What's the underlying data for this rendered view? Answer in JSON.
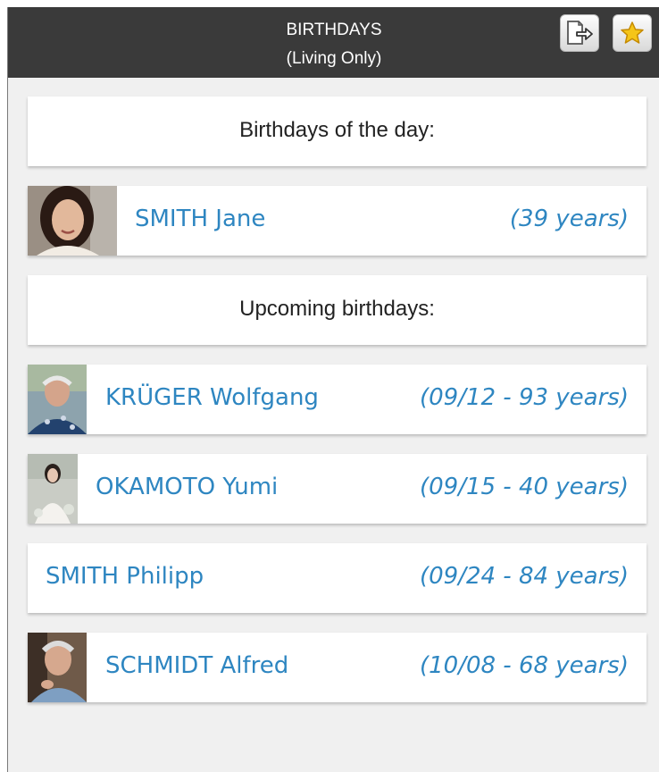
{
  "header": {
    "title_line1": "BIRTHDAYS",
    "title_line2": "(Living Only)",
    "export_icon": "export-icon",
    "favorite_icon": "star-icon"
  },
  "sections": {
    "today_title": "Birthdays of the day:",
    "upcoming_title": "Upcoming birthdays:"
  },
  "today": [
    {
      "name": "SMITH Jane",
      "info": "(39 years)",
      "has_photo": true
    }
  ],
  "upcoming": [
    {
      "name": "KRÜGER Wolfgang",
      "info": "(09/12 - 93 years)",
      "has_photo": true
    },
    {
      "name": "OKAMOTO Yumi",
      "info": "(09/15 - 40 years)",
      "has_photo": true
    },
    {
      "name": "SMITH Philipp",
      "info": "(09/24 - 84 years)",
      "has_photo": false
    },
    {
      "name": "SCHMIDT Alfred",
      "info": "(10/08 - 68 years)",
      "has_photo": true
    }
  ],
  "colors": {
    "header_bg": "#3a3a3a",
    "link": "#2e86c1",
    "panel_bg": "#f0f0f0"
  }
}
